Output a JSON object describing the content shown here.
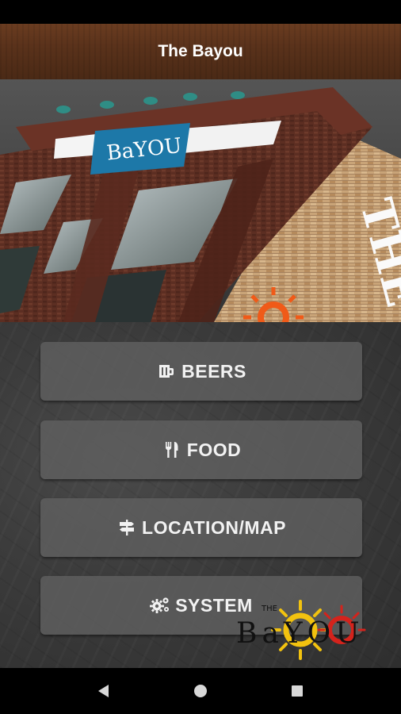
{
  "app_bar": {
    "title": "The Bayou"
  },
  "menu": {
    "beers": {
      "label": "BEERS",
      "icon": "beer-mug-icon"
    },
    "food": {
      "label": "FOOD",
      "icon": "fork-knife-icon"
    },
    "location": {
      "label": "LOCATION/MAP",
      "icon": "signpost-icon"
    },
    "system": {
      "label": "SYSTEM",
      "icon": "gears-icon"
    }
  },
  "hero": {
    "sign_text": "BaYOU",
    "wall_text": "THE BaY"
  },
  "logo": {
    "small_text": "THE",
    "text": "BaYOU"
  },
  "colors": {
    "app_bar": "#5a321b",
    "button_bg": "#5f5f5f",
    "button_text": "#f2f2f2",
    "logo_sun": "#f2c20f",
    "logo_red": "#d4231c"
  },
  "nav": {
    "back": "back-icon",
    "home": "home-icon",
    "recents": "recents-icon"
  }
}
